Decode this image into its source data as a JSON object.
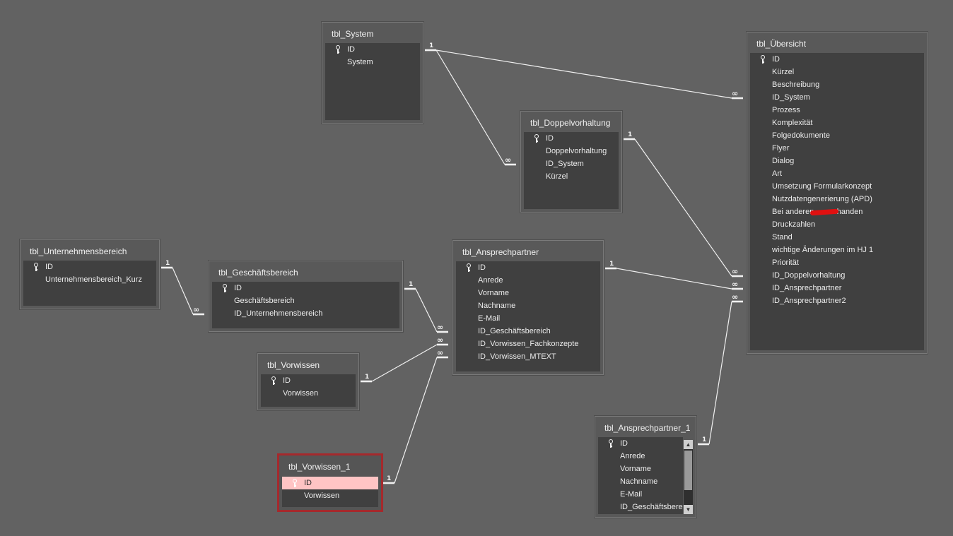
{
  "tables": {
    "system": {
      "title": "tbl_System",
      "fields": [
        "ID",
        "System"
      ]
    },
    "uebersicht": {
      "title": "tbl_Übersicht",
      "fields": [
        "ID",
        "Kürzel",
        "Beschreibung",
        "ID_System",
        "Prozess",
        "Komplexität",
        "Folgedokumente",
        "Flyer",
        "Dialog",
        "Art",
        "Umsetzung Formularkonzept",
        "Nutzdatengenerierung (APD)",
        "Bei anderen … vorhanden",
        "Druckzahlen",
        "Stand",
        "wichtige Änderungen im HJ 1",
        "Priorität",
        "ID_Doppelvorhaltung",
        "ID_Ansprechpartner",
        "ID_Ansprechpartner2"
      ]
    },
    "doppelvorhaltung": {
      "title": "tbl_Doppelvorhaltung",
      "fields": [
        "ID",
        "Doppelvorhaltung",
        "ID_System",
        "Kürzel"
      ]
    },
    "unternehmensbereich": {
      "title": "tbl_Unternehmensbereich",
      "fields": [
        "ID",
        "Unternehmensbereich_Kurz"
      ]
    },
    "geschaeftsbereich": {
      "title": "tbl_Geschäftsbereich",
      "fields": [
        "ID",
        "Geschäftsbereich",
        "ID_Unternehmensbereich"
      ]
    },
    "ansprechpartner": {
      "title": "tbl_Ansprechpartner",
      "fields": [
        "ID",
        "Anrede",
        "Vorname",
        "Nachname",
        "E-Mail",
        "ID_Geschäftsbereich",
        "ID_Vorwissen_Fachkonzepte",
        "ID_Vorwissen_MTEXT"
      ]
    },
    "vorwissen": {
      "title": "tbl_Vorwissen",
      "fields": [
        "ID",
        "Vorwissen"
      ]
    },
    "vorwissen_1": {
      "title": "tbl_Vorwissen_1",
      "fields": [
        "ID",
        "Vorwissen"
      ]
    },
    "ansprechpartner_1": {
      "title": "tbl_Ansprechpartner_1",
      "fields": [
        "ID",
        "Anrede",
        "Vorname",
        "Nachname",
        "E-Mail",
        "ID_Geschäftsbere"
      ]
    }
  },
  "relationship_labels": {
    "one": "1",
    "many": "∞"
  },
  "colors": {
    "background": "#626262",
    "table_body": "#404040",
    "selection_border": "#a5292c",
    "selected_row": "#ffc4c4",
    "redaction": "#e01010"
  },
  "icons": {
    "primary_key": "key-icon",
    "scroll_up": "scroll-up-arrow-icon",
    "scroll_down": "scroll-down-arrow-icon"
  }
}
